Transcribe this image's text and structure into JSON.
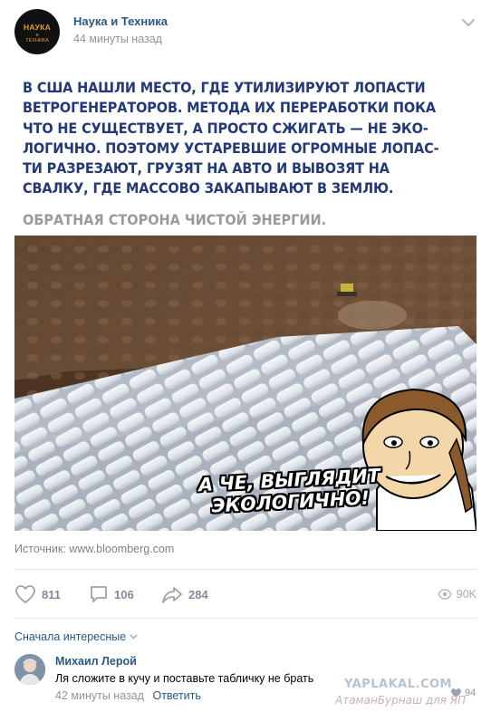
{
  "post": {
    "group_name": "Наука и Техника",
    "time": "44 минуты назад",
    "avatar_text": {
      "line1": "НАУКА",
      "line2": "и",
      "line3": "ТЕХНИКА"
    },
    "headline": "В США НАШЛИ МЕСТО, ГДЕ УТИЛИЗИРУЮТ ЛОПАСТИ\nВЕТРОГЕНЕРАТОРОВ. МЕТОДА ИХ ПЕРЕРАБОТКИ ПОКА\nЧТО НЕ СУЩЕСТВУЕТ, А ПРОСТО СЖИГАТЬ — НЕ ЭКО-\nЛОГИЧНО. ПОЭТОМУ УСТАРЕВШИЕ ОГРОМНЫЕ ЛОПАС-\nТИ РАЗРЕЗАЮТ, ГРУЗЯТ НА АВТО И ВЫВОЗЯТ НА\nСВАЛКУ, ГДЕ МАССОВО ЗАКАПЫВАЮТ В ЗЕМЛЮ.",
    "subline": "ОБРАТНАЯ СТОРОНА ЧИСТОЙ ЭНЕРГИИ.",
    "image_caption": "А ЧЕ, ВЫГЛЯДИТ ЭКОЛОГИЧНО!",
    "source": "Источник: www.bloomberg.com"
  },
  "actions": {
    "likes": "811",
    "comments": "106",
    "shares": "284",
    "views": "90K"
  },
  "comments_section": {
    "sort_label": "Сначала интересные",
    "comment": {
      "author": "Михаил Лерой",
      "text": "Ля сложите в кучу и поставьте табличку не брать",
      "time": "42 минуты назад",
      "reply": "Ответить",
      "likes": "94"
    }
  },
  "watermarks": {
    "site": "YAPLAKAL.COM",
    "user": "АтаманБурнаш для ЯП"
  },
  "colors": {
    "link": "#2a5885",
    "headline": "#243a78",
    "muted": "#939393",
    "icon": "#99a2ad"
  }
}
